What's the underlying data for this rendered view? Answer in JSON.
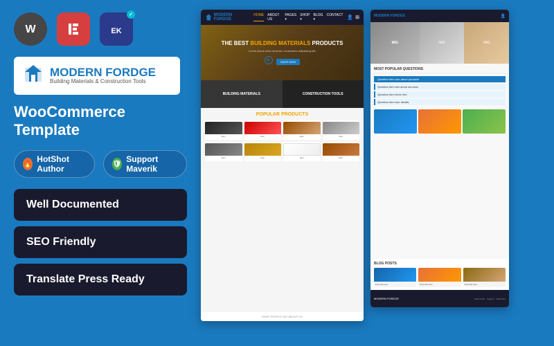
{
  "left": {
    "icons": {
      "wp_label": "W",
      "el_label": "E",
      "ek_label": "EK"
    },
    "logo": {
      "name": "MODERN FORDGE",
      "subtitle": "Building Materials & Construction Tools"
    },
    "template_type": "WooCommerce Template",
    "badges": {
      "hotshot": "HotShot Author",
      "support": "Support Maverik"
    },
    "features": [
      "Well Documented",
      "SEO Friendly",
      "Translate Press Ready"
    ]
  },
  "preview_main": {
    "nav_logo": "MODERN FORDGE",
    "nav_links": [
      "HOME",
      "ABOUT US",
      "PAGES",
      "SHOP",
      "BLOG",
      "CONTACT"
    ],
    "hero_title_line1": "THE BEST",
    "hero_title_highlight": "BUILDING MATERIALS",
    "hero_title_line2": "PRODUCTS",
    "hero_desc": "Lorem ipsum dolor sit amet, consectetur adipiscing elit.",
    "hero_btn": "SHOP NOW",
    "banner1": "BUILDING MATERIALS",
    "banner2": "CONSTRUCTION TOOLS",
    "products_title": "POPULAR",
    "products_title2": "PRODUCTS",
    "about_text": "WHAT PEOPLE SAY ABOUT US"
  },
  "preview_secondary": {
    "hero_text": "MOST POPULAR QUESTIONS",
    "list_items": [
      "Item one",
      "Item two",
      "Item three",
      "Item four"
    ],
    "blog_title": "BLOG POSTS",
    "footer_text": "MODERN FORDGE"
  }
}
